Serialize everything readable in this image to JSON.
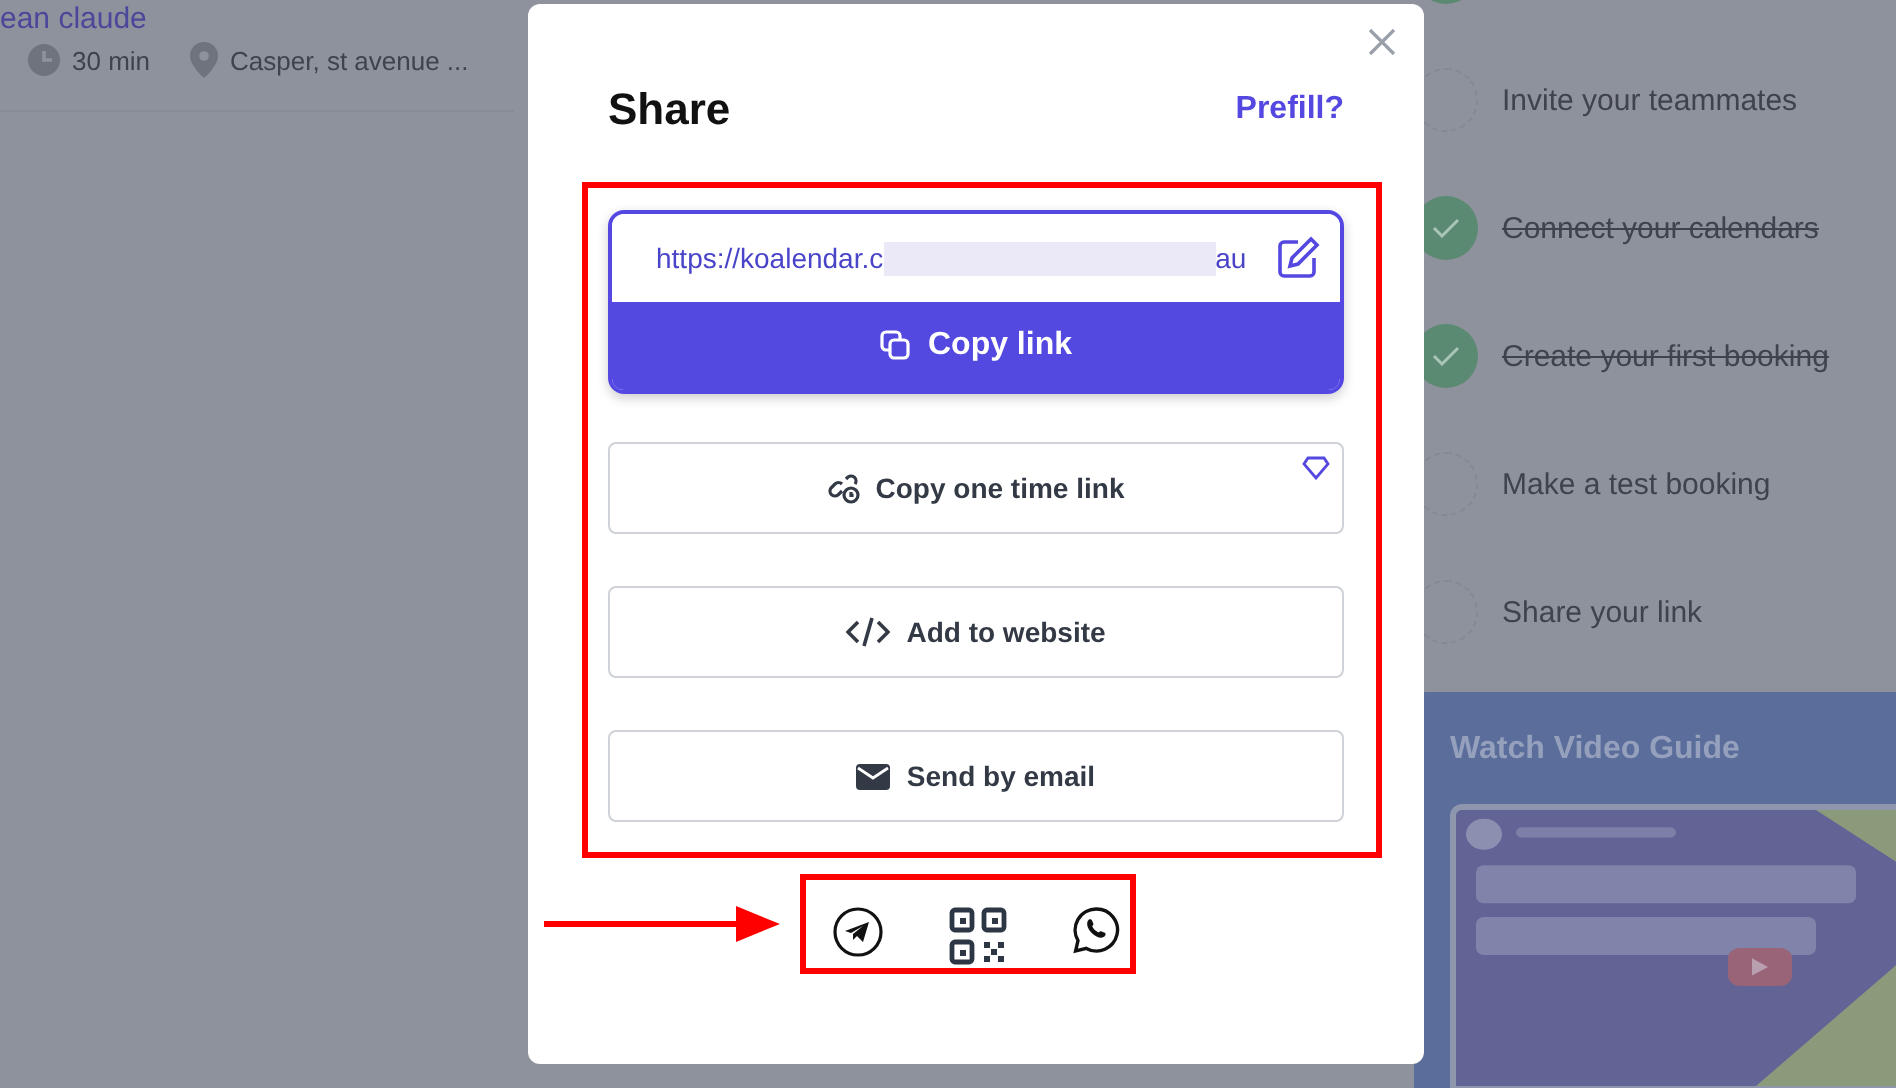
{
  "event": {
    "title": "ean claude",
    "duration": "30 min",
    "location": "Casper, st avenue ..."
  },
  "checklist": [
    {
      "done": true
    },
    {
      "label": "Invite your teammates",
      "done": false
    },
    {
      "label": "Connect your calendars",
      "done": true
    },
    {
      "label": "Create your first booking",
      "done": true
    },
    {
      "label": "Make a test booking",
      "done": false
    },
    {
      "label": "Share your link",
      "done": false
    }
  ],
  "video_guide": {
    "title": "Watch Video Guide",
    "kind": "picture"
  },
  "share_dialog": {
    "title": "Share",
    "prefill_link": "Prefill?",
    "url_start": "https://koalendar.c",
    "url_end": "au",
    "actions": [
      {
        "kind": "copy_link",
        "label": "Copy link"
      },
      {
        "kind": "one_time",
        "label": "Copy one time link",
        "premium": true
      },
      {
        "kind": "embed",
        "label": "Add to website",
        "premium": false
      },
      {
        "kind": "email",
        "label": "Send by email",
        "premium": false
      }
    ],
    "share_icons": [
      {
        "kind": "telegram"
      },
      {
        "kind": "qr"
      },
      {
        "kind": "whatsapp"
      }
    ]
  },
  "annotations": {
    "actions_highlighted": true,
    "icons_highlighted": true,
    "arrow_to_icons": true
  }
}
